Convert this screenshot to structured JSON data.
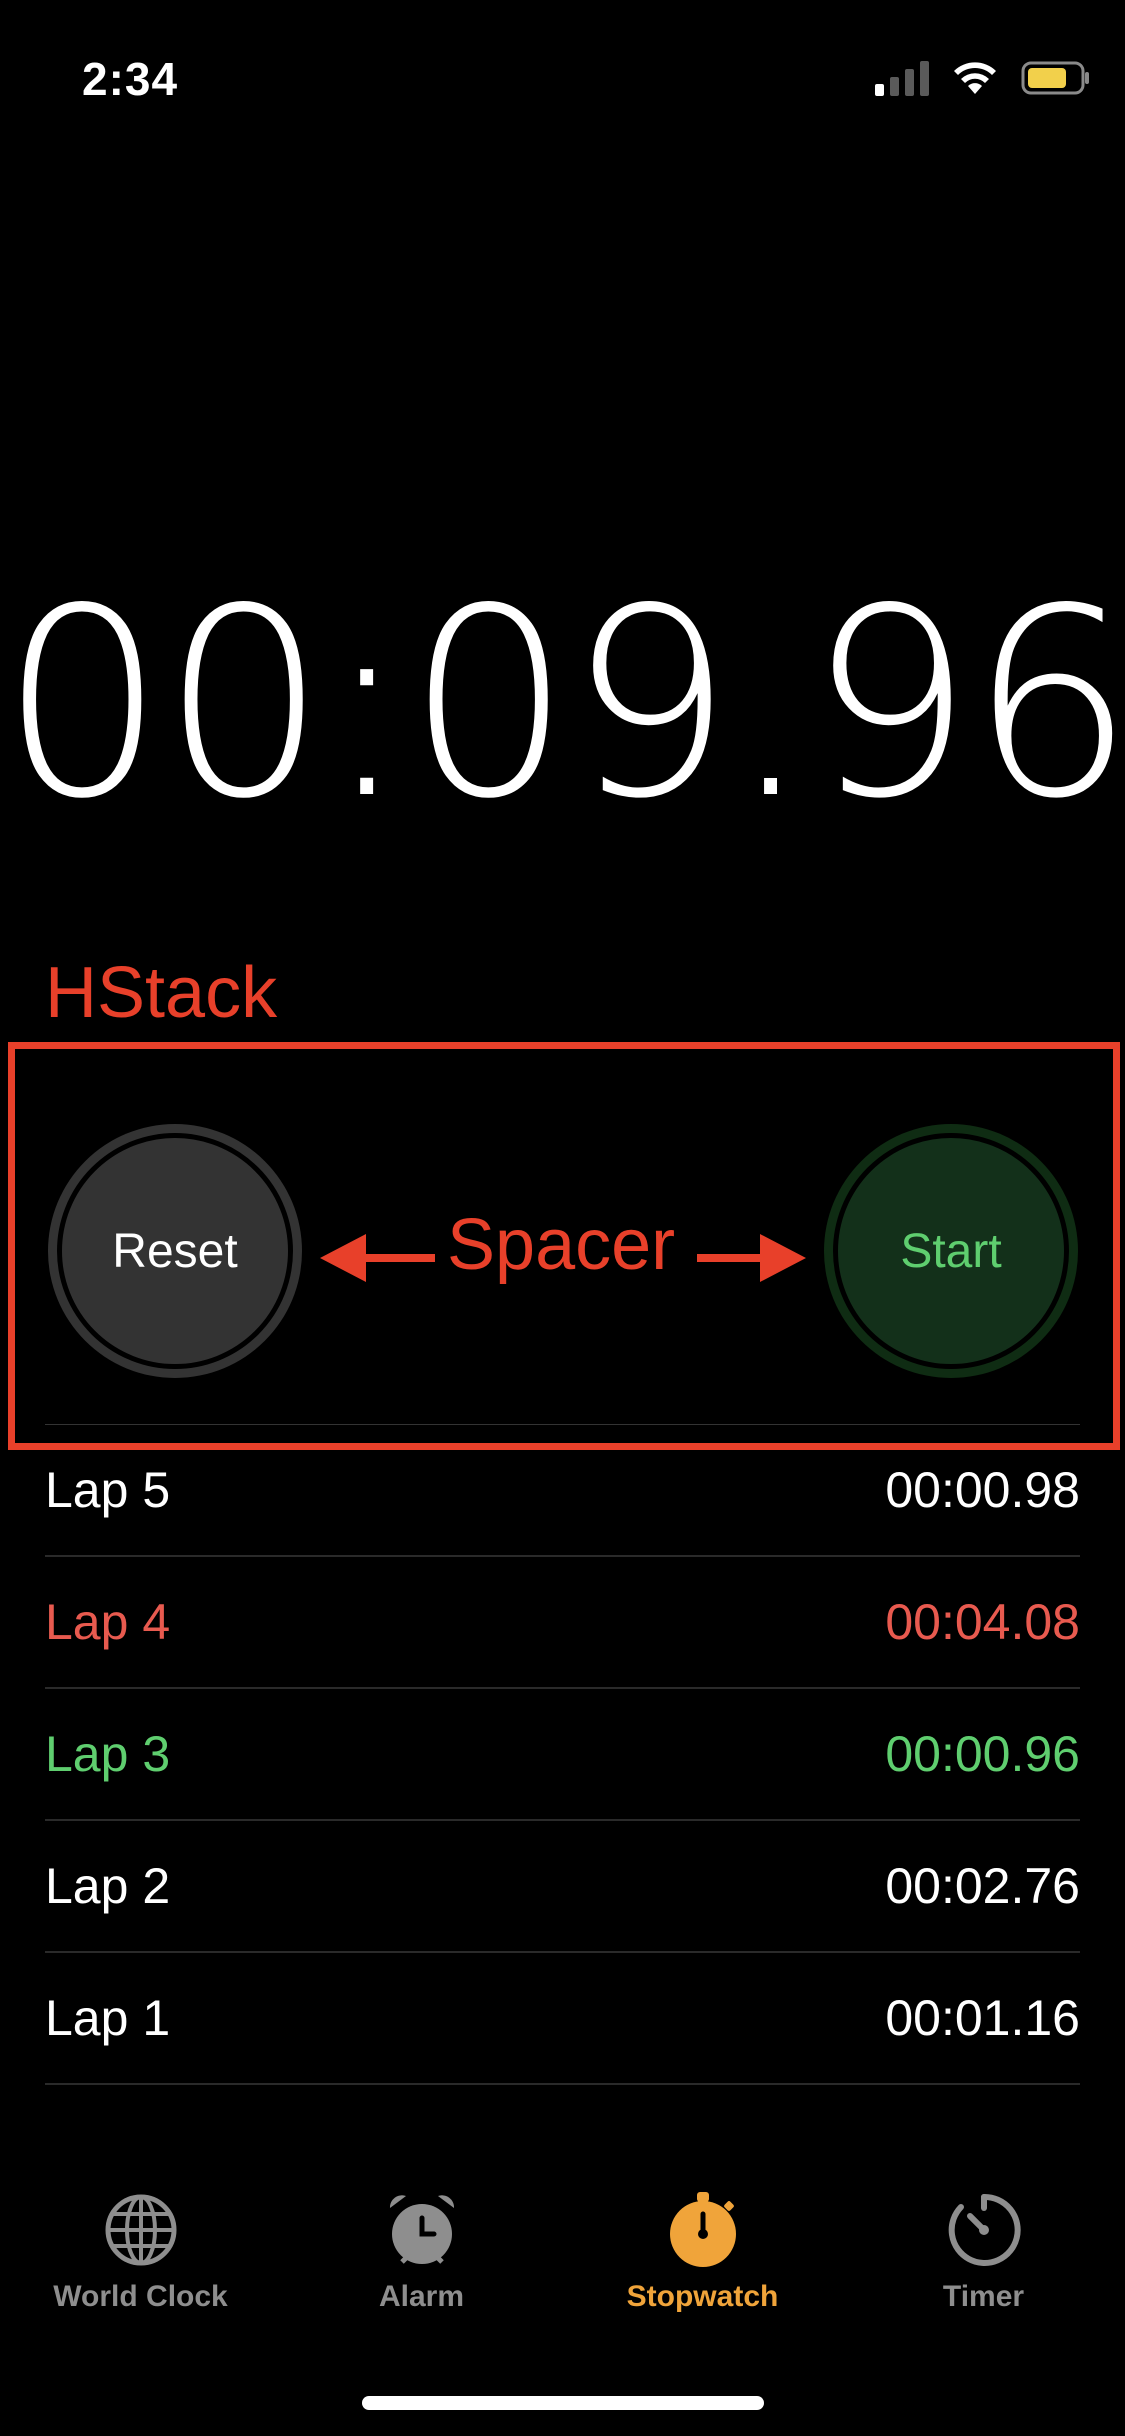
{
  "status_bar": {
    "time": "2:34"
  },
  "stopwatch": {
    "display": "00:09.96"
  },
  "annotations": {
    "hstack_label": "HStack",
    "spacer_label": "Spacer",
    "color": "#e8402a"
  },
  "controls": {
    "reset_label": "Reset",
    "start_label": "Start"
  },
  "laps": [
    {
      "label": "Lap 5",
      "time": "00:00.98",
      "style": "normal"
    },
    {
      "label": "Lap 4",
      "time": "00:04.08",
      "style": "slowest"
    },
    {
      "label": "Lap 3",
      "time": "00:00.96",
      "style": "fastest"
    },
    {
      "label": "Lap 2",
      "time": "00:02.76",
      "style": "normal"
    },
    {
      "label": "Lap 1",
      "time": "00:01.16",
      "style": "normal"
    }
  ],
  "tabs": [
    {
      "label": "World Clock",
      "icon": "globe-icon",
      "active": false
    },
    {
      "label": "Alarm",
      "icon": "alarm-clock-icon",
      "active": false
    },
    {
      "label": "Stopwatch",
      "icon": "stopwatch-icon",
      "active": true
    },
    {
      "label": "Timer",
      "icon": "timer-icon",
      "active": false
    }
  ],
  "colors": {
    "accent": "#f0a43a",
    "slowest_lap": "#e85a4f",
    "fastest_lap": "#5fce6f",
    "inactive_tab": "#8e8e8e"
  }
}
